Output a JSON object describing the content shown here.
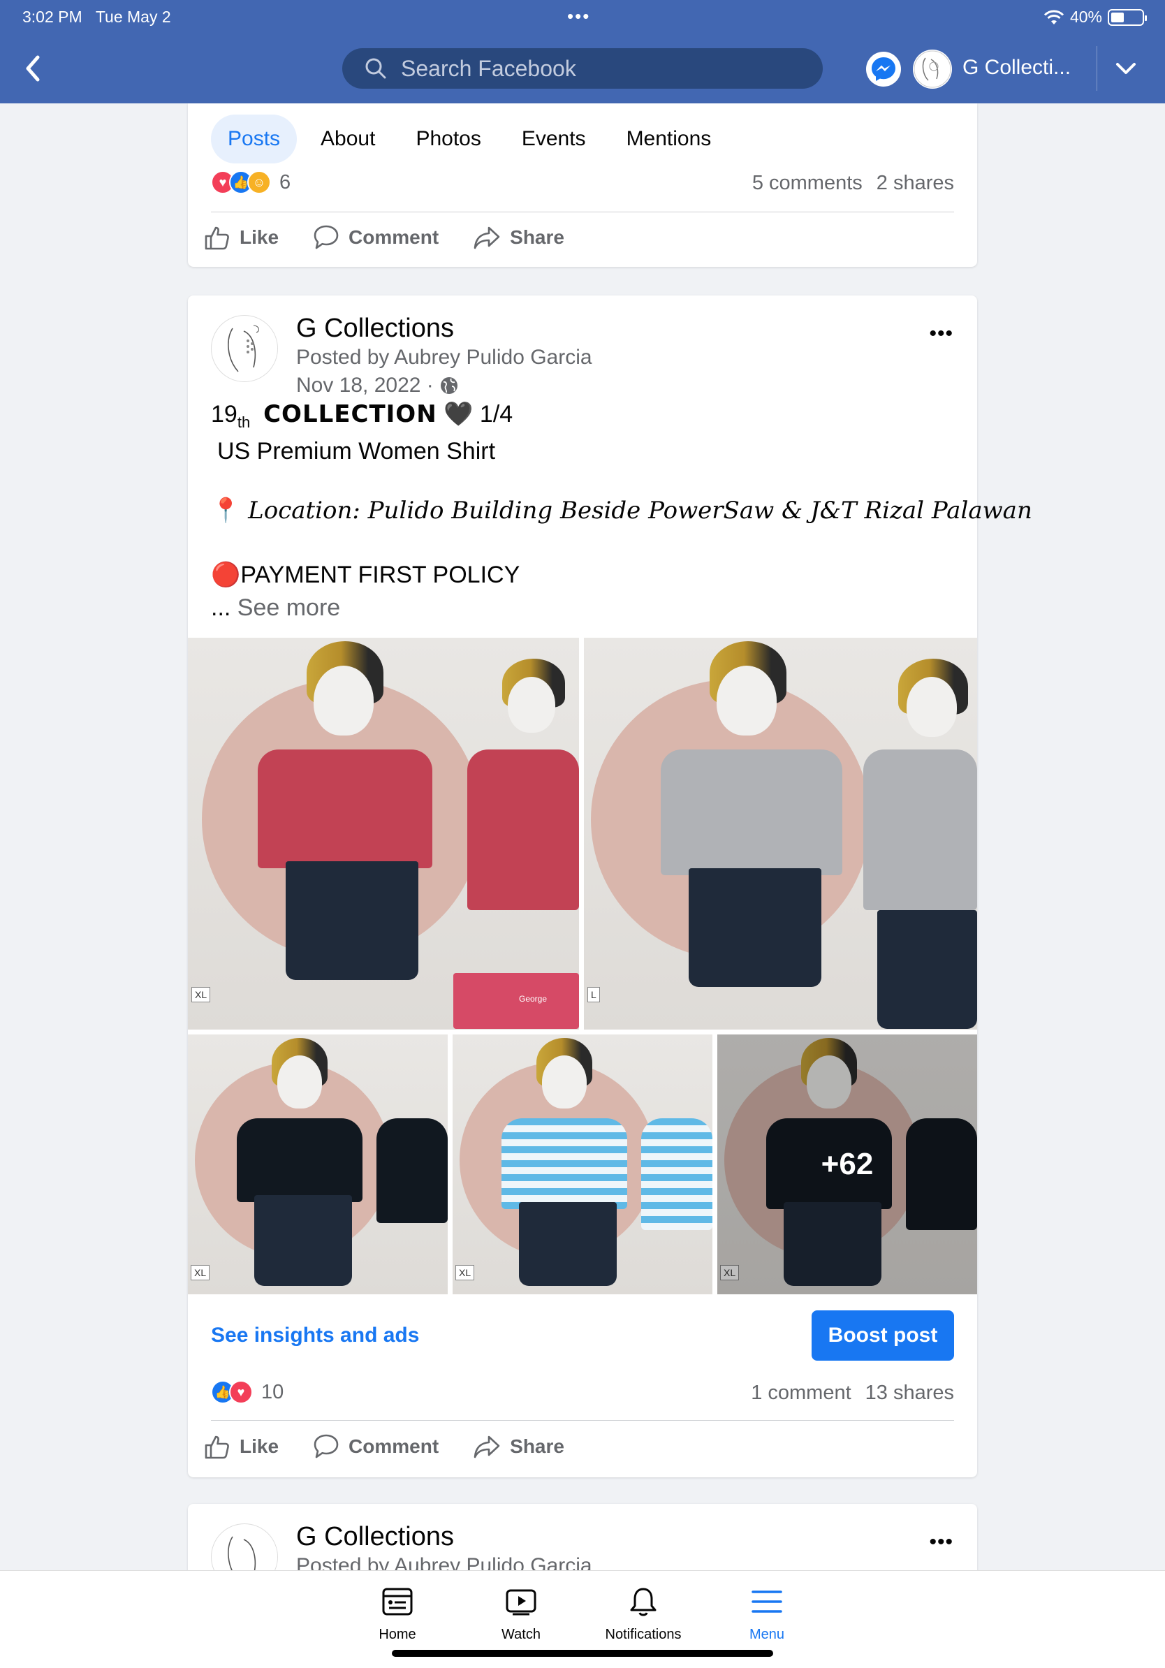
{
  "status_bar": {
    "time": "3:02 PM",
    "date": "Tue May 2",
    "battery": "40%",
    "battery_level": 0.4
  },
  "header": {
    "search_placeholder": "Search Facebook",
    "profile_name": "G Collecti..."
  },
  "page_tabs": [
    "Posts",
    "About",
    "Photos",
    "Events",
    "Mentions"
  ],
  "active_tab": "Posts",
  "prev_post": {
    "reaction_count": "6",
    "comments": "5 comments",
    "shares": "2 shares"
  },
  "actions": {
    "like": "Like",
    "comment": "Comment",
    "share": "Share"
  },
  "post": {
    "page_name": "G Collections",
    "posted_by": "Posted by Aubrey Pulido Garcia",
    "date": "Nov 18, 2022 ·",
    "collection_num": "19",
    "collection_sub": "th",
    "collection_word": "COLLECTION",
    "heart": "🖤",
    "collection_part": "1/4",
    "shirt": "US Premium Women Shirt",
    "location_pin": "📍",
    "location": "Location: Pulido Building Beside  PowerSaw & J&T Rizal Palawan",
    "policy_dot": "🔴",
    "policy": "PAYMENT FIRST POLICY",
    "see_more_dots": "...",
    "see_more": "See more",
    "more_photos": "+62",
    "insights": "See insights and ads",
    "boost": "Boost post",
    "reaction_count": "10",
    "comments": "1 comment",
    "shares": "13 shares"
  },
  "next_post": {
    "page_name": "G Collections",
    "posted_by": "Posted by Aubrey Pulido Garcia"
  },
  "photo_tags": [
    "XL",
    "L",
    "XL",
    "XL",
    "XL"
  ],
  "label_tag": "George",
  "bottom_nav": [
    {
      "label": "Home",
      "icon": "home-icon"
    },
    {
      "label": "Watch",
      "icon": "watch-icon"
    },
    {
      "label": "Notifications",
      "icon": "bell-icon"
    },
    {
      "label": "Menu",
      "icon": "menu-icon"
    }
  ],
  "colors": {
    "brand_bar": "#4267b2",
    "accent": "#1877f2",
    "background": "#f0f2f5"
  }
}
